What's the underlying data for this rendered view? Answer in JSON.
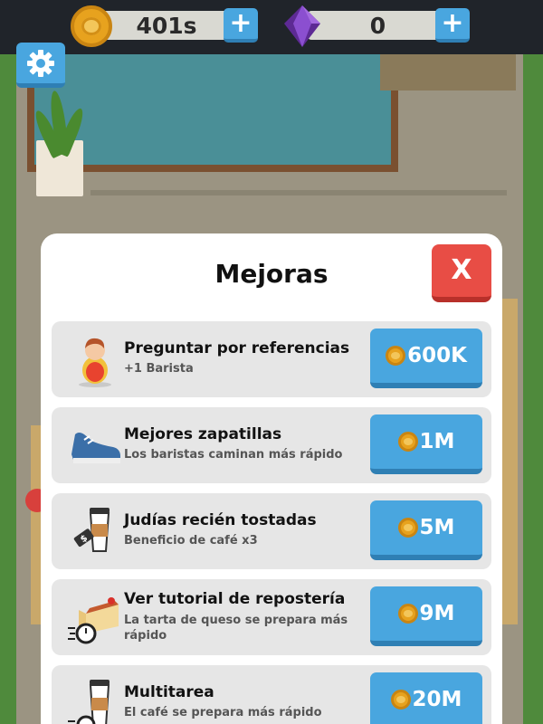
{
  "topbar": {
    "coins": "401s",
    "gems": "0",
    "add_symbol": "+"
  },
  "colors": {
    "primary_button": "#49a6df",
    "close_button": "#e84d45",
    "coin": "#e7a21e",
    "gem": "#7a3fb8"
  },
  "modal": {
    "title": "Mejoras",
    "close_label": "X",
    "upgrades": [
      {
        "title": "Preguntar por referencias",
        "subtitle": "+1 Barista",
        "price": "600K",
        "icon": "barista-icon"
      },
      {
        "title": "Mejores zapatillas",
        "subtitle": "Los baristas caminan más rápido",
        "price": "1M",
        "icon": "sneaker-icon"
      },
      {
        "title": "Judías recién tostadas",
        "subtitle": "Beneficio de café x3",
        "price": "5M",
        "icon": "coffee-price-tag-icon"
      },
      {
        "title": "Ver tutorial de repostería",
        "subtitle": "La tarta de queso se prepara más rápido",
        "price": "9M",
        "icon": "cheesecake-speed-icon"
      },
      {
        "title": "Multitarea",
        "subtitle": "El café se prepara más rápido",
        "price": "20M",
        "icon": "coffee-speed-icon"
      }
    ]
  }
}
